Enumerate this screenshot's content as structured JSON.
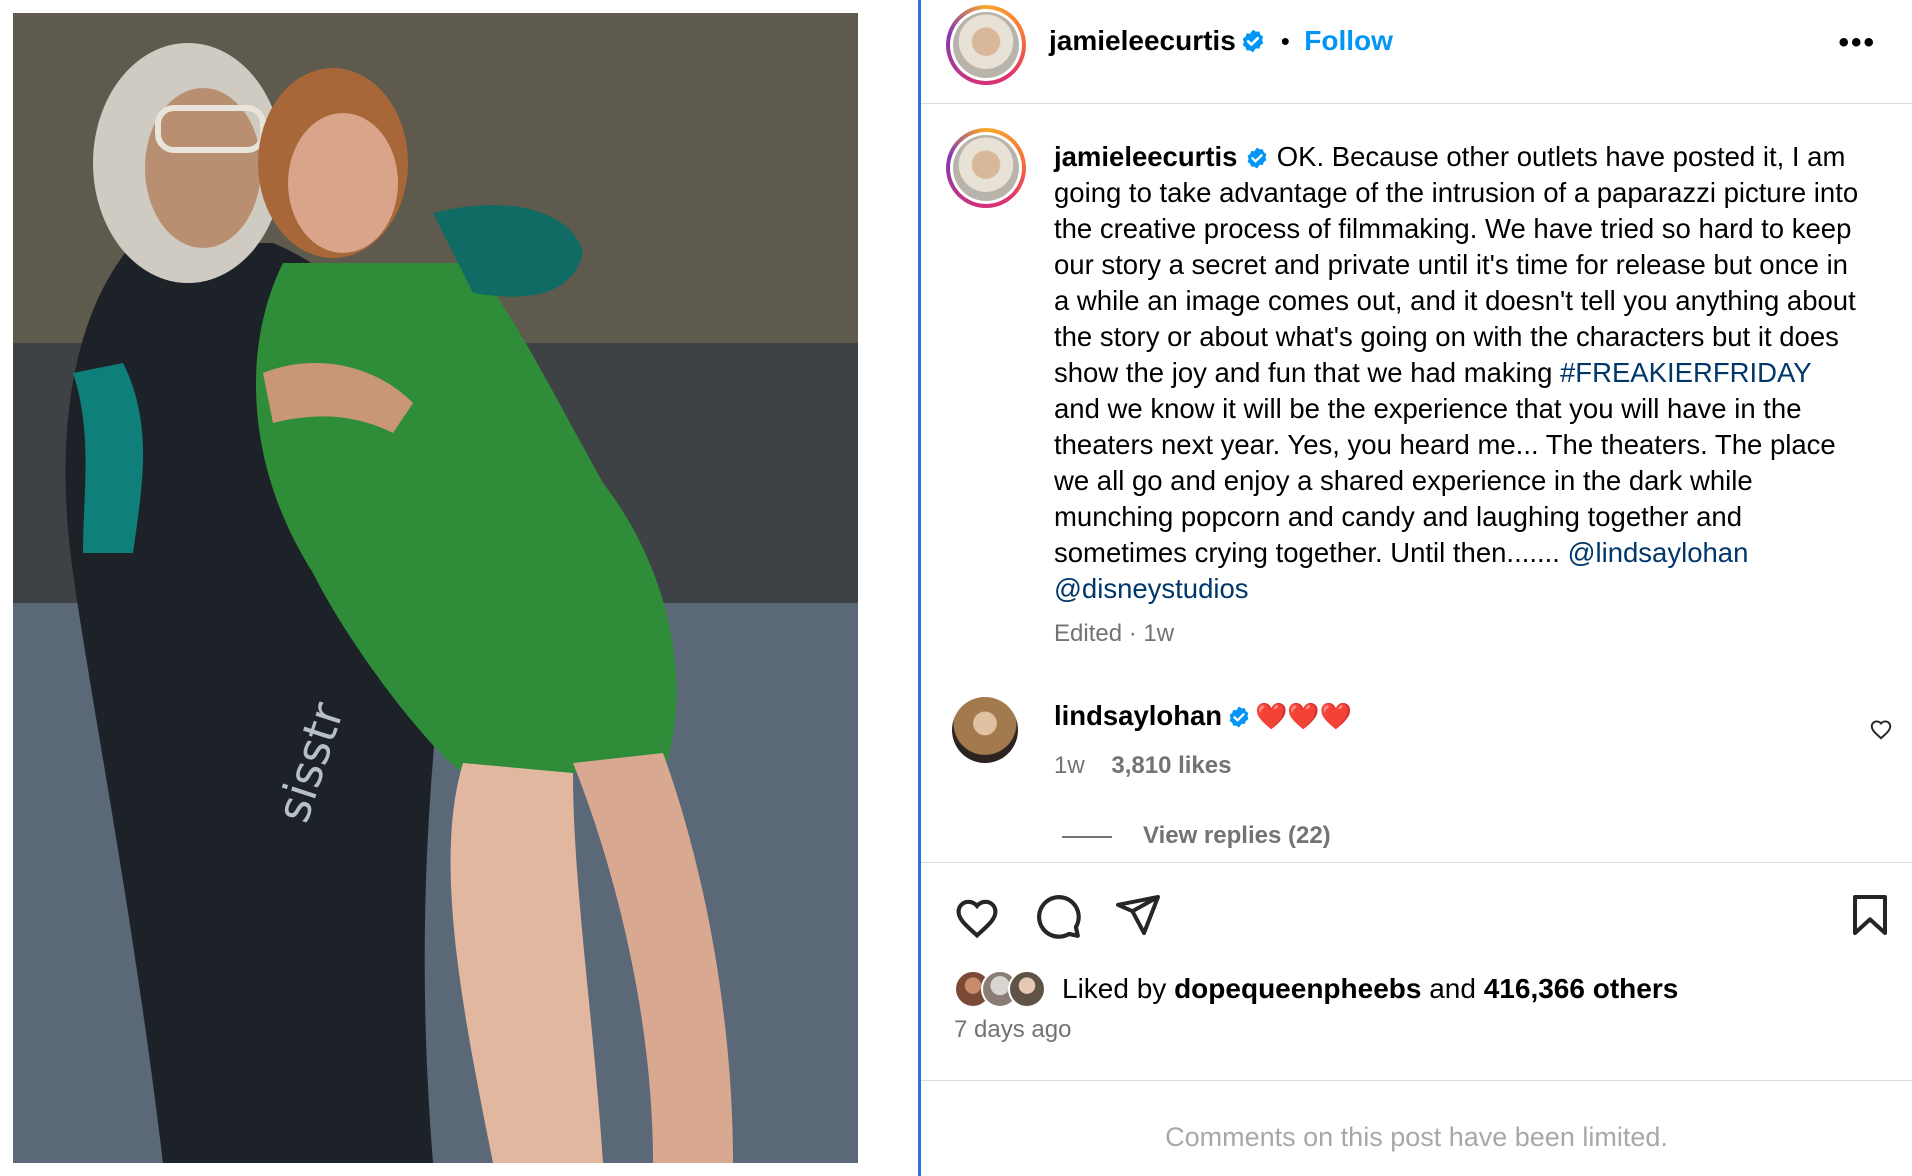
{
  "post": {
    "author": "jamieleecurtis",
    "follow_label": "Follow",
    "separator": "•",
    "more_label": "•••"
  },
  "caption": {
    "author": "jamieleecurtis",
    "text_before_tag": "OK. Because other outlets have posted it, I am going to take advantage of the intrusion of a paparazzi picture into the creative process of filmmaking. We have tried so hard to keep our story a secret and private until it's time for release but once in a while an image comes out, and it doesn't tell you anything about the story or about what's going on with the characters but it does show the joy and fun that we had making",
    "hashtag": "#FREAKIERFRIDAY",
    "text_after_tag": "and we know it will be the experience that you will have in the theaters next year. Yes, you heard me... The theaters. The place we all go and enjoy a shared experience in the dark while munching popcorn and candy and laughing together and sometimes crying together. Until then.......",
    "mention_1": "@lindsaylohan",
    "mention_2": "@disneystudios",
    "edited_label": "Edited",
    "dot": "·",
    "time": "1w"
  },
  "comment": {
    "author": "lindsaylohan",
    "text": "❤️❤️❤️",
    "time": "1w",
    "likes": "3,810 likes",
    "view_replies": "View replies (22)"
  },
  "likes": {
    "prefix": "Liked by",
    "user": "dopequeenpheebs",
    "middle": "and",
    "count": "416,366 others",
    "date": "7 days ago"
  },
  "footer": {
    "limited_text": "Comments on this post have been limited."
  },
  "colors": {
    "link_blue": "#0095f6",
    "tag_blue": "#00376b",
    "grey": "#737373",
    "verified_blue": "#0095f6"
  },
  "icons": [
    "verified-icon",
    "more-icon",
    "heart-icon",
    "comment-icon",
    "share-icon",
    "bookmark-icon",
    "small-heart-icon"
  ]
}
